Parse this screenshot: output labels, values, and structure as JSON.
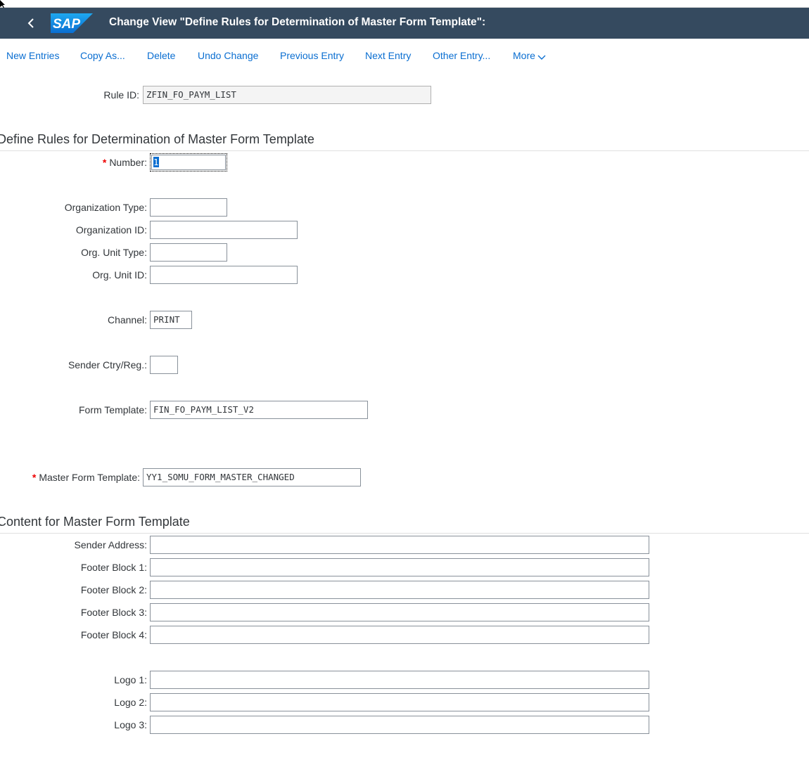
{
  "shell": {
    "title": "Change View \"Define Rules for Determination of Master Form Template\":",
    "logo_text": "SAP",
    "back_icon": "chevron-left-icon"
  },
  "toolbar": {
    "new_entries": "New Entries",
    "copy_as": "Copy As...",
    "delete": "Delete",
    "undo_change": "Undo Change",
    "previous_entry": "Previous Entry",
    "next_entry": "Next Entry",
    "other_entry": "Other Entry...",
    "more": "More"
  },
  "header": {
    "rule_id_label": "Rule ID:",
    "rule_id_value": "ZFIN_FO_PAYM_LIST"
  },
  "rules_section": {
    "title": "Define Rules for Determination of Master Form Template",
    "number_label": "Number:",
    "number_value": "1",
    "org_type_label": "Organization Type:",
    "org_type_value": "",
    "org_id_label": "Organization ID:",
    "org_id_value": "",
    "org_unit_type_label": "Org. Unit Type:",
    "org_unit_type_value": "",
    "org_unit_id_label": "Org. Unit ID:",
    "org_unit_id_value": "",
    "channel_label": "Channel:",
    "channel_value": "PRINT",
    "sender_ctry_label": "Sender Ctry/Reg.:",
    "sender_ctry_value": "",
    "form_template_label": "Form Template:",
    "form_template_value": "FIN_FO_PAYM_LIST_V2",
    "master_form_label": "Master Form Template:",
    "master_form_value": "YY1_SOMU_FORM_MASTER_CHANGED",
    "required_marker": "*"
  },
  "content_section": {
    "title": "Content for Master Form Template",
    "sender_address_label": "Sender Address:",
    "sender_address_value": "",
    "footer1_label": "Footer Block 1:",
    "footer1_value": "",
    "footer2_label": "Footer Block 2:",
    "footer2_value": "",
    "footer3_label": "Footer Block 3:",
    "footer3_value": "",
    "footer4_label": "Footer Block 4:",
    "footer4_value": "",
    "logo1_label": "Logo 1:",
    "logo1_value": "",
    "logo2_label": "Logo 2:",
    "logo2_value": "",
    "logo3_label": "Logo 3:",
    "logo3_value": ""
  },
  "colors": {
    "shell_bg": "#354a5f",
    "link": "#0a6ed1",
    "required": "#e00000",
    "sap_blue": "#0a7fd6"
  }
}
